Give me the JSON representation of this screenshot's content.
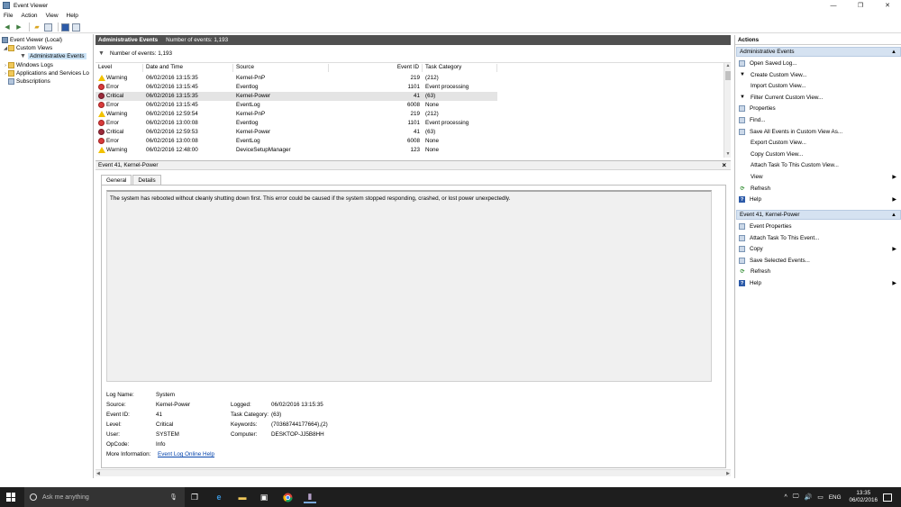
{
  "window": {
    "title": "Event Viewer",
    "controls": {
      "minimize": "—",
      "maximize": "❐",
      "close": "✕"
    }
  },
  "menu": [
    "File",
    "Action",
    "View",
    "Help"
  ],
  "tree": {
    "items": [
      {
        "label": "Event Viewer (Local)",
        "icon": "event-viewer-icon"
      },
      {
        "label": "Custom Views",
        "icon": "folder-icon"
      },
      {
        "label": "Administrative Events",
        "icon": "filter-icon"
      },
      {
        "label": "Windows Logs",
        "icon": "folder-icon"
      },
      {
        "label": "Applications and Services Lo",
        "icon": "folder-icon"
      },
      {
        "label": "Subscriptions",
        "icon": "log-icon"
      }
    ]
  },
  "center": {
    "header_title": "Administrative Events",
    "header_count": "Number of events: 1,193",
    "filter_count": "Number of events: 1,193",
    "columns": [
      "Level",
      "Date and Time",
      "Source",
      "Event ID",
      "Task Category"
    ],
    "rows": [
      {
        "level": "Warning",
        "icon": "warning",
        "date": "06/02/2016 13:15:35",
        "source": "Kernel-PnP",
        "id": "219",
        "category": "(212)"
      },
      {
        "level": "Error",
        "icon": "error",
        "date": "06/02/2016 13:15:45",
        "source": "Eventlog",
        "id": "1101",
        "category": "Event processing"
      },
      {
        "level": "Critical",
        "icon": "critical",
        "date": "06/02/2016 13:15:35",
        "source": "Kernel-Power",
        "id": "41",
        "category": "(63)"
      },
      {
        "level": "Error",
        "icon": "error",
        "date": "06/02/2016 13:15:45",
        "source": "EventLog",
        "id": "6008",
        "category": "None"
      },
      {
        "level": "Warning",
        "icon": "warning",
        "date": "06/02/2016 12:59:54",
        "source": "Kernel-PnP",
        "id": "219",
        "category": "(212)"
      },
      {
        "level": "Error",
        "icon": "error",
        "date": "06/02/2016 13:00:08",
        "source": "Eventlog",
        "id": "1101",
        "category": "Event processing"
      },
      {
        "level": "Critical",
        "icon": "critical",
        "date": "06/02/2016 12:59:53",
        "source": "Kernel-Power",
        "id": "41",
        "category": "(63)"
      },
      {
        "level": "Error",
        "icon": "error",
        "date": "06/02/2016 13:00:08",
        "source": "EventLog",
        "id": "6008",
        "category": "None"
      },
      {
        "level": "Warning",
        "icon": "warning",
        "date": "06/02/2016 12:48:00",
        "source": "DeviceSetupManager",
        "id": "123",
        "category": "None"
      }
    ]
  },
  "detail": {
    "title": "Event 41, Kernel-Power",
    "close": "×",
    "tabs": [
      "General",
      "Details"
    ],
    "description": "The system has rebooted without cleanly shutting down first. This error could be caused if the system stopped responding, crashed, or lost power unexpectedly.",
    "props": {
      "log_name_label": "Log Name:",
      "log_name": "System",
      "source_label": "Source:",
      "source": "Kernel-Power",
      "logged_label": "Logged:",
      "logged": "06/02/2016 13:15:35",
      "event_id_label": "Event ID:",
      "event_id": "41",
      "task_label": "Task Category:",
      "task": "(63)",
      "level_label": "Level:",
      "level": "Critical",
      "keywords_label": "Keywords:",
      "keywords": "(70368744177664),(2)",
      "user_label": "User:",
      "user": "SYSTEM",
      "computer_label": "Computer:",
      "computer": "DESKTOP-JJ5B8HH",
      "opcode_label": "OpCode:",
      "opcode": "Info",
      "more_info_label": "More Information:",
      "more_info": "Event Log Online Help"
    }
  },
  "actions": {
    "title": "Actions",
    "section1": "Administrative Events",
    "items1": [
      {
        "label": "Open Saved Log...",
        "icon": "open-log-icon"
      },
      {
        "label": "Create Custom View...",
        "icon": "create-view-icon"
      },
      {
        "label": "Import Custom View...",
        "icon": ""
      },
      {
        "label": "Filter Current Custom View...",
        "icon": "filter-icon"
      },
      {
        "label": "Properties",
        "icon": "properties-icon"
      },
      {
        "label": "Find...",
        "icon": "find-icon"
      },
      {
        "label": "Save All Events in Custom View As...",
        "icon": "save-icon"
      },
      {
        "label": "Export Custom View...",
        "icon": ""
      },
      {
        "label": "Copy Custom View...",
        "icon": ""
      },
      {
        "label": "Attach Task To This Custom View...",
        "icon": ""
      },
      {
        "label": "View",
        "icon": "",
        "submenu": true
      },
      {
        "label": "Refresh",
        "icon": "refresh-icon"
      },
      {
        "label": "Help",
        "icon": "help-icon",
        "submenu": true
      }
    ],
    "section2": "Event 41, Kernel-Power",
    "items2": [
      {
        "label": "Event Properties",
        "icon": "event-properties-icon"
      },
      {
        "label": "Attach Task To This Event...",
        "icon": "attach-task-icon"
      },
      {
        "label": "Copy",
        "icon": "copy-icon",
        "submenu": true
      },
      {
        "label": "Save Selected Events...",
        "icon": "save-icon"
      },
      {
        "label": "Refresh",
        "icon": "refresh-icon"
      },
      {
        "label": "Help",
        "icon": "help-icon",
        "submenu": true
      }
    ]
  },
  "taskbar": {
    "search_placeholder": "Ask me anything",
    "language": "ENG",
    "time": "13:35",
    "date": "06/02/2016"
  }
}
